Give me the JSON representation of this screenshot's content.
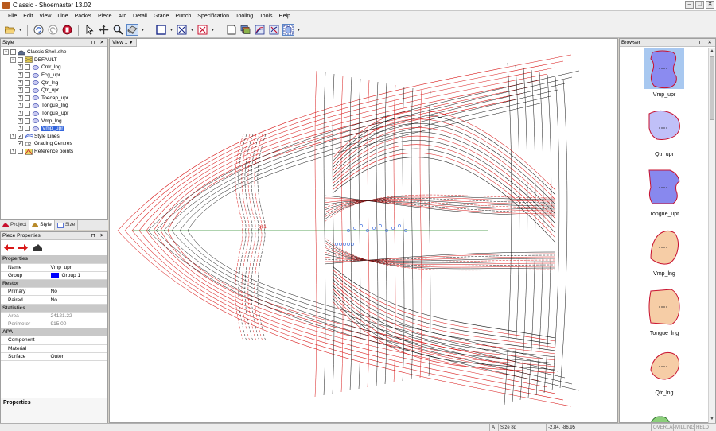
{
  "window": {
    "title": "Classic - Shoemaster 13.02"
  },
  "menu": [
    "File",
    "Edit",
    "View",
    "Line",
    "Packet",
    "Piece",
    "Arc",
    "Detail",
    "Grade",
    "Punch",
    "Specification",
    "Tooling",
    "Tools",
    "Help"
  ],
  "toolbar": {
    "icons": [
      "open-folder-icon",
      "undo-icon",
      "redo-icon",
      "stop-icon",
      "pointer-icon",
      "move-icon",
      "zoom-icon",
      "eraser-icon",
      "rectangle-icon",
      "fit-icon",
      "fit-all-icon",
      "new-piece-icon",
      "stack-icon",
      "grade-piece-icon",
      "cut-piece-icon",
      "select-piece-icon"
    ]
  },
  "style_panel": {
    "title": "Style",
    "root": "Classic Shell.she",
    "group": "DEFAULT",
    "pieces": [
      "Cntr_lng",
      "Fcg_upr",
      "Qtr_lng",
      "Qtr_upr",
      "Toecap_upr",
      "Tongue_lng",
      "Tongue_upr",
      "Vmp_lng",
      "Vmp_upr"
    ],
    "selected": "Vmp_upr",
    "extra": [
      "Style Lines",
      "Grading Centres",
      "Reference points"
    ],
    "tabs": [
      "Project",
      "Style",
      "Size"
    ],
    "active_tab": "Style"
  },
  "piece_properties": {
    "title": "Piece Properties",
    "rows": [
      {
        "cat": "Properties"
      },
      {
        "k": "Name",
        "v": "Vmp_upr"
      },
      {
        "k": "Group",
        "v": "Group 1",
        "swatch": "#0000ff"
      },
      {
        "cat": "Restor"
      },
      {
        "k": "Primary",
        "v": "No"
      },
      {
        "k": "Paired",
        "v": "No"
      },
      {
        "cat": "Statistics"
      },
      {
        "k": "Area",
        "v": "24121.22",
        "ro": true
      },
      {
        "k": "Perimeter",
        "v": "915.00",
        "ro": true
      },
      {
        "cat": "APA"
      },
      {
        "k": "Component",
        "v": ""
      },
      {
        "k": "Material",
        "v": ""
      },
      {
        "k": "Surface",
        "v": "Outer"
      }
    ],
    "footer_title": "Properties"
  },
  "view": {
    "tab": "View 1",
    "label_red": "gc1"
  },
  "browser": {
    "title": "Browser",
    "items": [
      {
        "name": "Vmp_upr",
        "fill": "#8b8bf0",
        "selected": true
      },
      {
        "name": "Qtr_upr",
        "fill": "#c0c0f8",
        "selected": false
      },
      {
        "name": "Tongue_upr",
        "fill": "#8888ee",
        "selected": false
      },
      {
        "name": "Vmp_lng",
        "fill": "#f6cda6",
        "selected": false
      },
      {
        "name": "Tongue_lng",
        "fill": "#f6cda6",
        "selected": false
      },
      {
        "name": "Qtr_lng",
        "fill": "#f6cda6",
        "selected": false
      }
    ]
  },
  "statusbar": {
    "mode": "A",
    "size": "Size 8d",
    "coords": "-2.84, -86.95",
    "flags": [
      "OVERLAP",
      "MILLING",
      "HELD"
    ]
  }
}
